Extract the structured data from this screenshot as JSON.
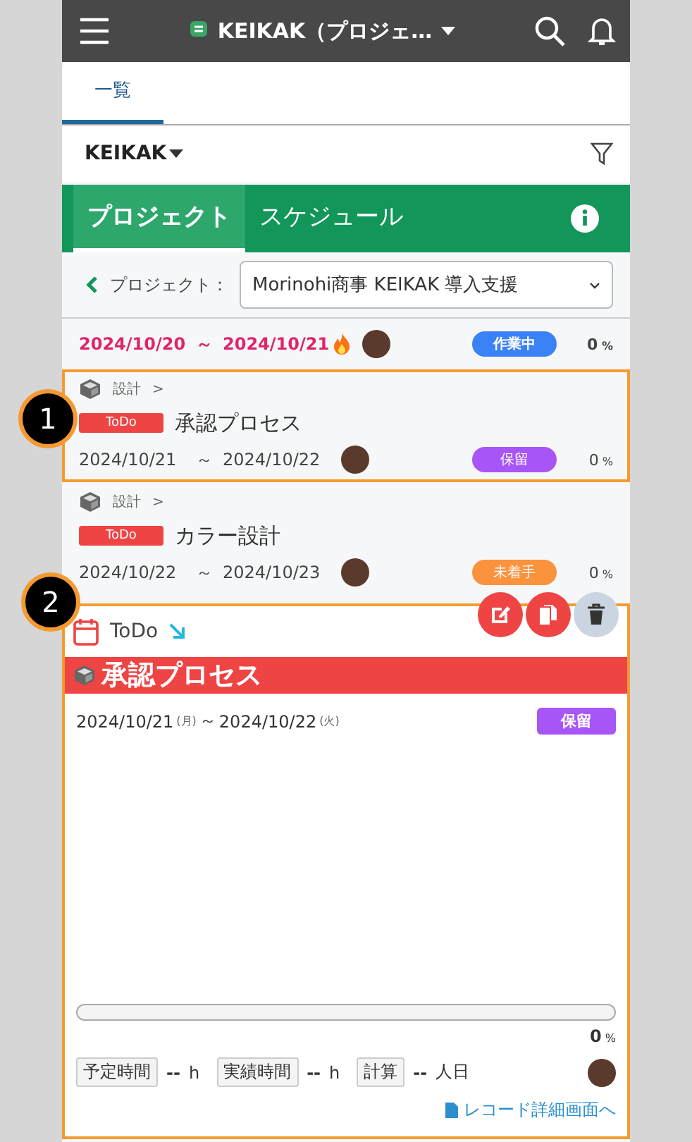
{
  "header": {
    "title": "KEIKAK（プロジェ…"
  },
  "tabs": [
    {
      "label": "一覧",
      "selected": true
    }
  ],
  "filter": {
    "app": "KEIKAK"
  },
  "mode_tabs": [
    {
      "label": "プロジェクト",
      "selected": true
    },
    {
      "label": "スケジュール",
      "selected": false
    }
  ],
  "project_select": {
    "label": "プロジェクト：",
    "value": "Morinohi商事 KEIKAK 導入支援"
  },
  "tasks": [
    {
      "kind": "partial",
      "start": "2024/10/20",
      "sep": "～",
      "end": "2024/10/21",
      "overdue": true,
      "hot": true,
      "status": "作業中",
      "color": "#3b82f6",
      "progress": "0",
      "unit": "%",
      "highlighted": false
    },
    {
      "kind": "full",
      "category": "設計",
      "path_sep": ">",
      "type": "ToDo",
      "title": "承認プロセス",
      "start": "2024/10/21",
      "sep": "～",
      "end": "2024/10/22",
      "overdue": false,
      "hot": false,
      "status": "保留",
      "color": "#a855f7",
      "progress": "0",
      "unit": "%",
      "highlighted": true,
      "marker": "1"
    },
    {
      "kind": "full",
      "category": "設計",
      "path_sep": ">",
      "type": "ToDo",
      "title": "カラー設計",
      "start": "2024/10/22",
      "sep": "～",
      "end": "2024/10/23",
      "overdue": false,
      "hot": false,
      "status": "未着手",
      "color": "#fb923c",
      "progress": "0",
      "unit": "%",
      "highlighted": false
    }
  ],
  "detail": {
    "marker": "2",
    "type": "ToDo",
    "title": "承認プロセス",
    "start": "2024/10/21",
    "start_day": "(月)",
    "sep": "～",
    "end": "2024/10/22",
    "end_day": "(火)",
    "status": "保留",
    "level": 0,
    "progress": "0",
    "unit": "%",
    "planned_label": "予定時間",
    "planned": "--",
    "planned_unit": "h",
    "actual_label": "実績時間",
    "actual": "--",
    "actual_unit": "h",
    "calc_label": "計算",
    "calc": "--",
    "calc_unit": "人日",
    "link": "レコード詳細画面へ"
  }
}
